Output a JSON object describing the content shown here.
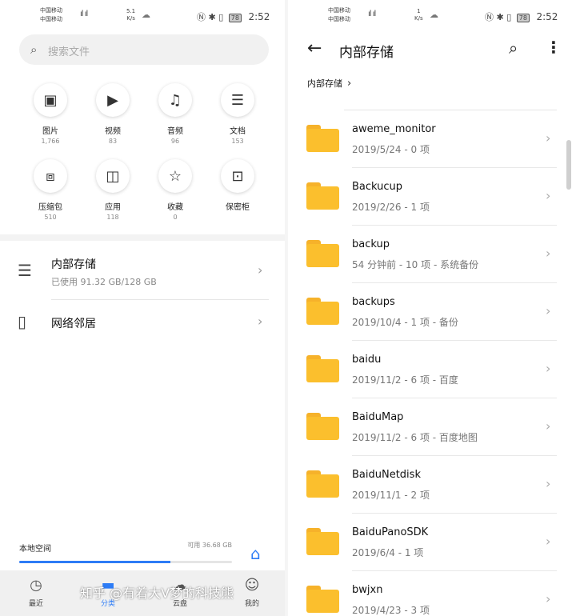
{
  "left": {
    "status": {
      "carrier1": "中国移动",
      "carrier2": "中国移动",
      "speed_val": "5.1",
      "speed_unit": "K/s",
      "battery": "78",
      "time": "2:52"
    },
    "search_placeholder": "搜索文件",
    "categories": [
      {
        "label": "图片",
        "count": "1,766"
      },
      {
        "label": "视频",
        "count": "83"
      },
      {
        "label": "音频",
        "count": "96"
      },
      {
        "label": "文档",
        "count": "153"
      },
      {
        "label": "压缩包",
        "count": "510"
      },
      {
        "label": "应用",
        "count": "118"
      },
      {
        "label": "收藏",
        "count": "0"
      },
      {
        "label": "保密柜",
        "count": ""
      }
    ],
    "internal_storage": {
      "title": "内部存储",
      "subtitle": "已使用 91.32 GB/128 GB"
    },
    "network": {
      "title": "网络邻居"
    },
    "local_space": {
      "label": "本地空间",
      "available": "可用 36.68 GB",
      "used_fraction": 0.71
    },
    "nav": [
      {
        "label": "最近"
      },
      {
        "label": "分类"
      },
      {
        "label": "云盘"
      },
      {
        "label": "我的"
      }
    ],
    "accent_color": "#2d7cf6"
  },
  "right": {
    "status": {
      "carrier1": "中国移动",
      "carrier2": "中国移动",
      "speed_val": "1",
      "speed_unit": "K/s",
      "battery": "78",
      "time": "2:52"
    },
    "title": "内部存储",
    "breadcrumb": "内部存储",
    "folders": [
      {
        "name": "aweme_monitor",
        "meta": "2019/5/24 - 0 项"
      },
      {
        "name": "Backucup",
        "meta": "2019/2/26 - 1 项"
      },
      {
        "name": "backup",
        "meta": "54 分钟前 - 10 项 - 系统备份"
      },
      {
        "name": "backups",
        "meta": "2019/10/4 - 1 项 - 备份"
      },
      {
        "name": "baidu",
        "meta": "2019/11/2 - 6 项 - 百度"
      },
      {
        "name": "BaiduMap",
        "meta": "2019/11/2 - 6 项 - 百度地图"
      },
      {
        "name": "BaiduNetdisk",
        "meta": "2019/11/1 - 2 项"
      },
      {
        "name": "BaiduPanoSDK",
        "meta": "2019/6/4 - 1 项"
      },
      {
        "name": "bwjxn",
        "meta": "2019/4/23 - 3 项"
      }
    ],
    "folder_color": "#fbbf2d"
  },
  "watermark": "知乎 @有着大V梦的科技熊"
}
